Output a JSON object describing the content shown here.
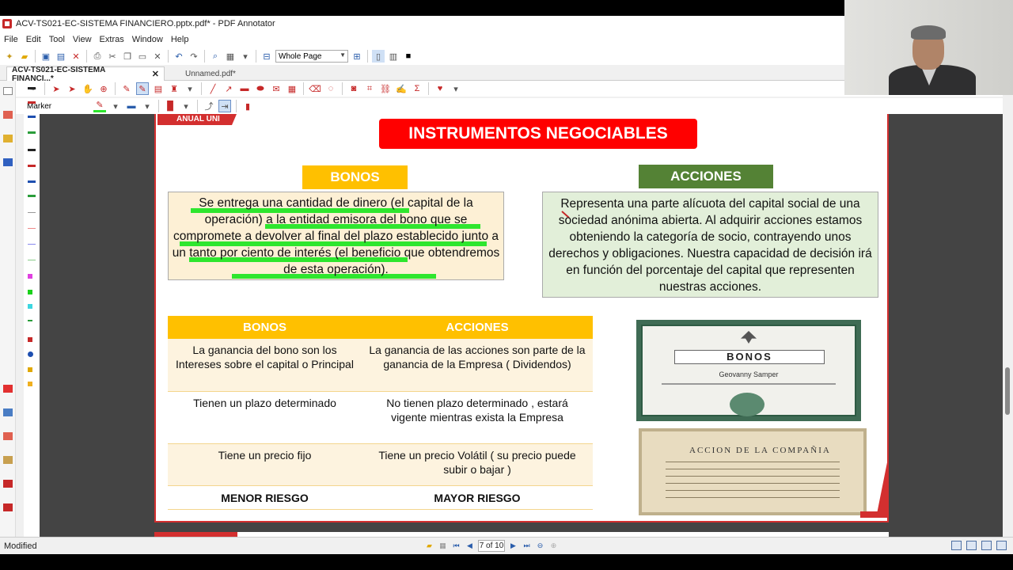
{
  "window": {
    "title": "ACV-TS021-EC-SISTEMA FINANCIERO.pptx.pdf* - PDF Annotator"
  },
  "menu": [
    "File",
    "Edit",
    "Tool",
    "View",
    "Extras",
    "Window",
    "Help"
  ],
  "toolbar": {
    "zoom_mode": "Whole Page",
    "tool_label": "Marker"
  },
  "tabs": [
    {
      "label": "ACV-TS021-EC-SISTEMA FINANCI...*",
      "active": true
    },
    {
      "label": "Unnamed.pdf*",
      "active": false
    }
  ],
  "slide": {
    "corner_label": "ANUAL UNI",
    "title": "INSTRUMENTOS NEGOCIABLES",
    "bonos_label": "BONOS",
    "acciones_label": "ACCIONES",
    "bonos_text": "Se entrega una cantidad de dinero (el capital de la operación) a la entidad emisora del bono que se compromete a devolver al final del plazo establecido junto a un tanto por ciento de interés (el beneficio que obtendremos de esta operación).",
    "acciones_text": "Representa una parte alícuota del capital social de una sociedad anónima abierta. Al adquirir acciones estamos obteniendo la categoría de socio, contrayendo unos derechos y obligaciones. Nuestra capacidad de decisión irá en función del porcentaje del capital que representen nuestras acciones.",
    "table": {
      "headers": [
        "BONOS",
        "ACCIONES"
      ],
      "rows": [
        [
          "La ganancia del bono son los Intereses sobre el capital o Principal",
          "La ganancia de las acciones son parte de la ganancia de la Empresa ( Dividendos)"
        ],
        [
          "Tienen un plazo determinado",
          "No tienen plazo determinado , estará vigente mientras exista la Empresa"
        ],
        [
          "Tiene un precio fijo",
          "Tiene un precio Volátil ( su precio puede subir o bajar )"
        ],
        [
          "MENOR RIESGO",
          "MAYOR RIESGO"
        ]
      ]
    },
    "cert_bonos_label": "BONOS",
    "cert_bonos_owner": "Geovanny Samper",
    "cert_acciones_title": "ACCION DE LA COMPAÑIA"
  },
  "status": {
    "left": "Modified",
    "page": "7 of 10"
  }
}
